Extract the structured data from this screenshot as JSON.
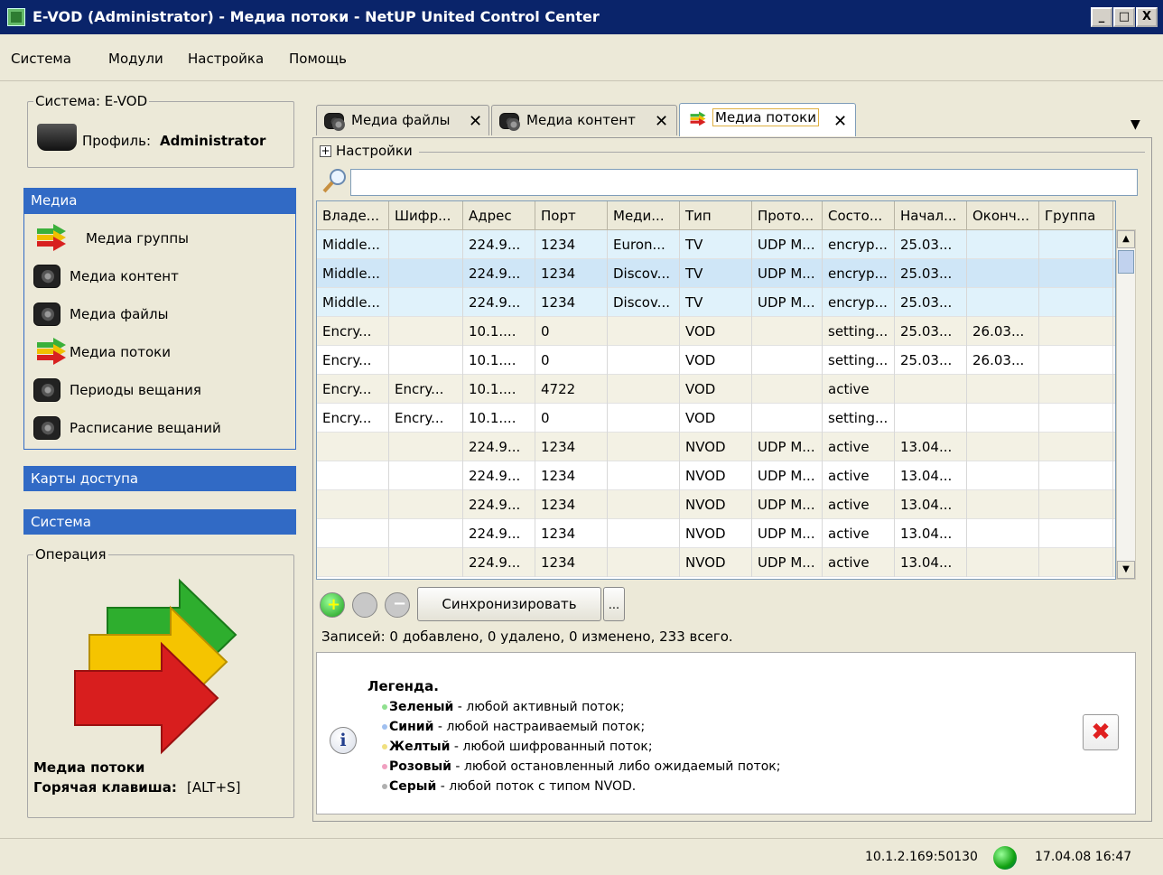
{
  "window": {
    "title": "E-VOD (Administrator) - Медиа потоки - NetUP United Control Center",
    "buttons": [
      "_",
      "□",
      "X"
    ]
  },
  "menu": [
    "Система",
    "Модули",
    "Настройка",
    "Помощь"
  ],
  "left": {
    "system_legend": "Система: E-VOD",
    "profile_label": "Профиль:",
    "profile_name": "Administrator",
    "media_header": "Медиа",
    "nav_items": [
      {
        "label": "Медиа группы",
        "icon": "arrows-icon"
      },
      {
        "label": "Медиа контент",
        "icon": "camera-icon"
      },
      {
        "label": "Медиа файлы",
        "icon": "camera-icon"
      },
      {
        "label": "Медиа потоки",
        "icon": "arrows-icon"
      },
      {
        "label": "Периоды вещания",
        "icon": "camera-icon"
      },
      {
        "label": "Расписание вещаний",
        "icon": "camera-icon"
      }
    ],
    "access_cards_header": "Карты доступа",
    "system_header": "Система",
    "operation_legend": "Операция",
    "operation_name": "Медиа потоки",
    "hotkey_label": "Горячая клавиша:",
    "hotkey_value": "[ALT+S]"
  },
  "tabs": [
    {
      "label": "Медиа файлы",
      "active": false
    },
    {
      "label": "Медиа контент",
      "active": false
    },
    {
      "label": "Медиа потоки",
      "active": true
    }
  ],
  "settings_label": "Настройки",
  "search": {
    "value": "",
    "placeholder": ""
  },
  "table": {
    "columns": [
      "Владе...",
      "Шифр...",
      "Адрес",
      "Порт",
      "Меди...",
      "Тип",
      "Прото...",
      "Состо...",
      "Начал...",
      "Оконч...",
      "Группа"
    ],
    "rows": [
      {
        "style": "blue",
        "cells": [
          "Middle...",
          "",
          "224.9...",
          "1234",
          "Euron...",
          "TV",
          "UDP M...",
          "encryp...",
          "25.03...",
          "",
          ""
        ]
      },
      {
        "style": "blue-sel",
        "cells": [
          "Middle...",
          "",
          "224.9...",
          "1234",
          "Discov...",
          "TV",
          "UDP M...",
          "encryp...",
          "25.03...",
          "",
          ""
        ]
      },
      {
        "style": "blue",
        "cells": [
          "Middle...",
          "",
          "224.9...",
          "1234",
          "Discov...",
          "TV",
          "UDP M...",
          "encryp...",
          "25.03...",
          "",
          ""
        ]
      },
      {
        "style": "beige",
        "cells": [
          "Encry...",
          "",
          "10.1....",
          "0",
          "",
          "VOD",
          "",
          "setting...",
          "25.03...",
          "26.03...",
          ""
        ]
      },
      {
        "style": "white",
        "cells": [
          "Encry...",
          "",
          "10.1....",
          "0",
          "",
          "VOD",
          "",
          "setting...",
          "25.03...",
          "26.03...",
          ""
        ]
      },
      {
        "style": "beige",
        "cells": [
          "Encry...",
          "Encry...",
          "10.1....",
          "4722",
          "",
          "VOD",
          "",
          "active",
          "",
          "",
          ""
        ]
      },
      {
        "style": "white",
        "cells": [
          "Encry...",
          "Encry...",
          "10.1....",
          "0",
          "",
          "VOD",
          "",
          "setting...",
          "",
          "",
          ""
        ]
      },
      {
        "style": "beige",
        "cells": [
          "",
          "",
          "224.9...",
          "1234",
          "",
          "NVOD",
          "UDP M...",
          "active",
          "13.04...",
          "",
          ""
        ]
      },
      {
        "style": "white",
        "cells": [
          "",
          "",
          "224.9...",
          "1234",
          "",
          "NVOD",
          "UDP M...",
          "active",
          "13.04...",
          "",
          ""
        ]
      },
      {
        "style": "beige",
        "cells": [
          "",
          "",
          "224.9...",
          "1234",
          "",
          "NVOD",
          "UDP M...",
          "active",
          "13.04...",
          "",
          ""
        ]
      },
      {
        "style": "white",
        "cells": [
          "",
          "",
          "224.9...",
          "1234",
          "",
          "NVOD",
          "UDP M...",
          "active",
          "13.04...",
          "",
          ""
        ]
      },
      {
        "style": "beige",
        "cells": [
          "",
          "",
          "224.9...",
          "1234",
          "",
          "NVOD",
          "UDP M...",
          "active",
          "13.04...",
          "",
          ""
        ]
      }
    ]
  },
  "toolbar": {
    "sync_label": "Синхронизировать",
    "more_label": "..."
  },
  "records_text": "Записей: 0 добавлено, 0 удалено, 0 изменено, 233 всего.",
  "legend": {
    "title": "Легенда.",
    "items": [
      {
        "bold": "Зеленый",
        "text": " - любой активный поток;",
        "color": "#90e090"
      },
      {
        "bold": "Синий",
        "text": " - любой настраиваемый поток;",
        "color": "#a0c0f0"
      },
      {
        "bold": "Желтый",
        "text": " - любой шифрованный поток;",
        "color": "#f0e080"
      },
      {
        "bold": "Розовый",
        "text": " - любой остановленный либо ожидаемый поток;",
        "color": "#f0a0c0"
      },
      {
        "bold": "Серый",
        "text": " - любой поток с типом NVOD.",
        "color": "#b0b0b0"
      }
    ],
    "info_glyph": "i",
    "close_glyph": "✖"
  },
  "status": {
    "address": "10.1.2.169:50130",
    "datetime": "17.04.08 16:47"
  },
  "colors": {
    "row_blue": "#e0f2fb",
    "row_blue_sel": "#cfe6f7",
    "row_beige": "#f3f1e4",
    "row_white": "#ffffff",
    "accent": "#316ac5"
  }
}
